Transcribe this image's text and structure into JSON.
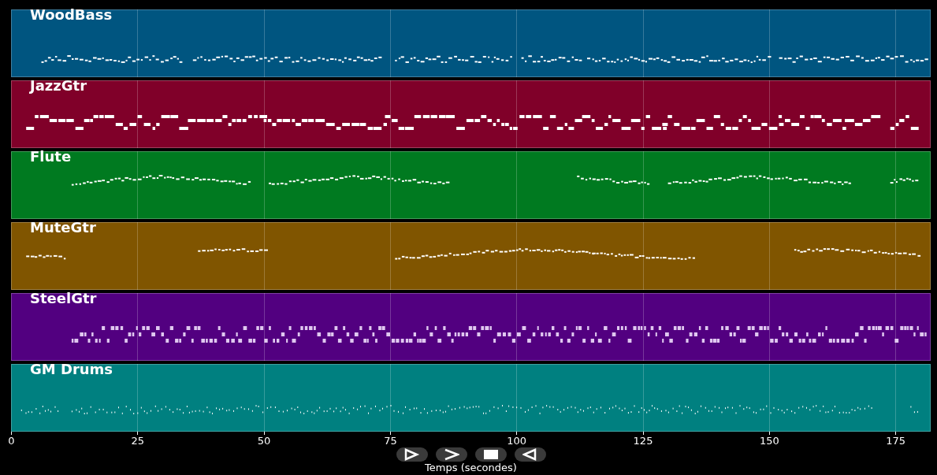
{
  "tracks": [
    {
      "name": "WoodBass",
      "color": "#005580"
    },
    {
      "name": "JazzGtr",
      "color": "#800029"
    },
    {
      "name": "Flute",
      "color": "#007a20"
    },
    {
      "name": "MuteGtr",
      "color": "#805500"
    },
    {
      "name": "SteelGtr",
      "color": "#520080"
    },
    {
      "name": "GM Drums",
      "color": "#008080"
    }
  ],
  "x_axis": {
    "ticks": [
      "0",
      "25",
      "50",
      "75",
      "100",
      "125",
      "150",
      "175"
    ],
    "label": "Temps (secondes)"
  },
  "controls": [
    {
      "kind": "play"
    },
    {
      "kind": "forward"
    },
    {
      "kind": "stop"
    },
    {
      "kind": "back"
    }
  ]
}
